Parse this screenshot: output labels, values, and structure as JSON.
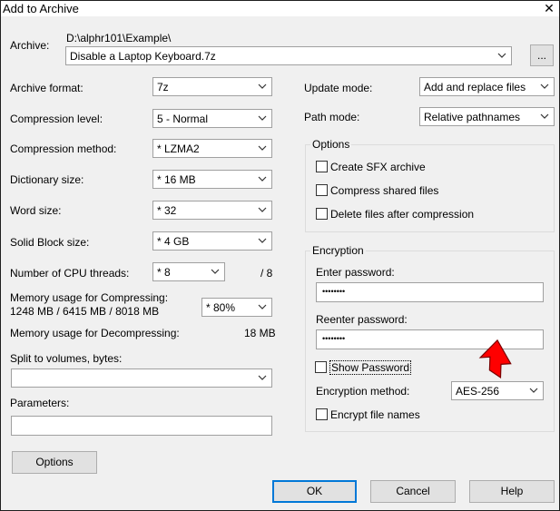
{
  "window": {
    "title": "Add to Archive",
    "close_glyph": "✕"
  },
  "archive": {
    "label": "Archive:",
    "path": "D:\\alphr101\\Example\\",
    "filename": "Disable a Laptop Keyboard.7z",
    "browse_label": "..."
  },
  "left": {
    "archive_format": {
      "label": "Archive format:",
      "value": "7z"
    },
    "compression_level": {
      "label": "Compression level:",
      "value": "5 - Normal"
    },
    "compression_method": {
      "label": "Compression method:",
      "value": "*  LZMA2"
    },
    "dictionary_size": {
      "label": "Dictionary size:",
      "value": "*  16 MB"
    },
    "word_size": {
      "label": "Word size:",
      "value": "*  32"
    },
    "solid_block_size": {
      "label": "Solid Block size:",
      "value": "*  4 GB"
    },
    "cpu_threads": {
      "label": "Number of CPU threads:",
      "value": "*  8",
      "total": "/ 8"
    },
    "memory_compressing": {
      "label": "Memory usage for Compressing:",
      "detail": "1248 MB / 6415 MB / 8018 MB",
      "value": "* 80%"
    },
    "memory_decompressing": {
      "label": "Memory usage for Decompressing:",
      "value": "18 MB"
    },
    "split_volumes": {
      "label": "Split to volumes, bytes:",
      "value": ""
    },
    "parameters": {
      "label": "Parameters:",
      "value": ""
    },
    "options_button": "Options"
  },
  "right": {
    "update_mode": {
      "label": "Update mode:",
      "value": "Add and replace files"
    },
    "path_mode": {
      "label": "Path mode:",
      "value": "Relative pathnames"
    },
    "options_group": {
      "title": "Options",
      "create_sfx": "Create SFX archive",
      "compress_shared": "Compress shared files",
      "delete_after": "Delete files after compression"
    },
    "encryption_group": {
      "title": "Encryption",
      "enter_password_label": "Enter password:",
      "enter_password_value": "••••••••",
      "reenter_password_label": "Reenter password:",
      "reenter_password_value": "••••••••",
      "show_password": "Show Password",
      "method_label": "Encryption method:",
      "method_value": "AES-256",
      "encrypt_names": "Encrypt file names"
    }
  },
  "footer": {
    "ok": "OK",
    "cancel": "Cancel",
    "help": "Help"
  },
  "colors": {
    "accent": "#0078d7",
    "annotation_arrow": "#ff0000"
  }
}
